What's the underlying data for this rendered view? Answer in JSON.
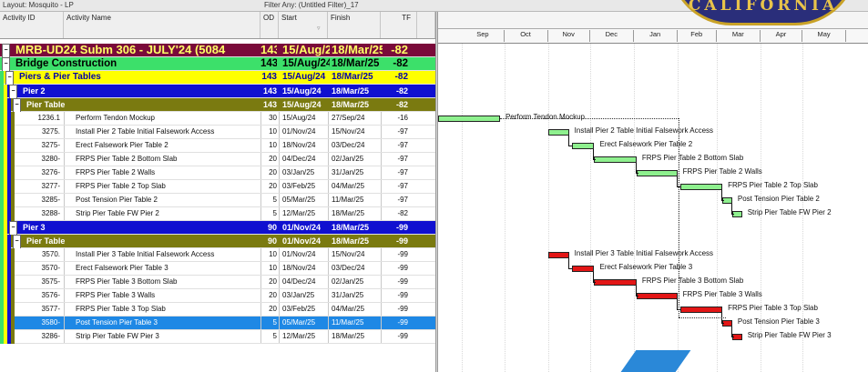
{
  "toolbar": {
    "layout_label": "Layout: Mosquito - LP",
    "filter_label": "Filter Any: (Untitled Filter)_17"
  },
  "columns": {
    "activity_id": "Activity ID",
    "activity_name": "Activity Name",
    "od": "OD",
    "start": "Start",
    "finish": "Finish",
    "tf": "TF"
  },
  "timeline": {
    "months": [
      "Sep",
      "Oct",
      "Nov",
      "Dec",
      "Jan",
      "Feb",
      "Mar",
      "Apr",
      "May"
    ]
  },
  "seal_text": "CALIFORNIA",
  "colors": {
    "wbs1": "#7a0a3a",
    "wbs2": "#3ce06a",
    "wbs3": "#ffff00",
    "wbs4": "#1010d0",
    "wbs5": "#7a7a10",
    "selected": "#1e88e5",
    "bar_green": "#8ef08e",
    "bar_red": "#e31616"
  },
  "rows": [
    {
      "kind": "band",
      "level": 1,
      "id": "",
      "name": "MRB-UD24 Subm 306 - JULY'24 (5084",
      "od": "143",
      "start": "15/Aug/24",
      "finish": "18/Mar/25",
      "tf": "-82"
    },
    {
      "kind": "band",
      "level": 2,
      "id": "",
      "name": "Bridge Construction",
      "od": "143",
      "start": "15/Aug/24",
      "finish": "18/Mar/25",
      "tf": "-82"
    },
    {
      "kind": "band",
      "level": 3,
      "id": "",
      "name": "Piers & Pier Tables",
      "od": "143",
      "start": "15/Aug/24",
      "finish": "18/Mar/25",
      "tf": "-82"
    },
    {
      "kind": "band",
      "level": 4,
      "id": "",
      "name": "Pier 2",
      "od": "143",
      "start": "15/Aug/24",
      "finish": "18/Mar/25",
      "tf": "-82"
    },
    {
      "kind": "band",
      "level": 5,
      "id": "",
      "name": "Pier Table",
      "od": "143",
      "start": "15/Aug/24",
      "finish": "18/Mar/25",
      "tf": "-82"
    },
    {
      "kind": "act",
      "id": "1236.1",
      "name": "Perform Tendon Mockup",
      "od": "30",
      "start": "15/Aug/24",
      "finish": "27/Sep/24",
      "tf": "-16"
    },
    {
      "kind": "act",
      "id": "3275.",
      "name": "Install Pier 2 Table Initial Falsework Access",
      "od": "10",
      "start": "01/Nov/24",
      "finish": "15/Nov/24",
      "tf": "-97"
    },
    {
      "kind": "act",
      "id": "3275-",
      "name": "Erect Falsework Pier Table 2",
      "od": "10",
      "start": "18/Nov/24",
      "finish": "03/Dec/24",
      "tf": "-97"
    },
    {
      "kind": "act",
      "id": "3280-",
      "name": "FRPS Pier Table 2 Bottom Slab",
      "od": "20",
      "start": "04/Dec/24",
      "finish": "02/Jan/25",
      "tf": "-97"
    },
    {
      "kind": "act",
      "id": "3276-",
      "name": "FRPS Pier Table 2 Walls",
      "od": "20",
      "start": "03/Jan/25",
      "finish": "31/Jan/25",
      "tf": "-97"
    },
    {
      "kind": "act",
      "id": "3277-",
      "name": "FRPS Pier Table 2 Top Slab",
      "od": "20",
      "start": "03/Feb/25",
      "finish": "04/Mar/25",
      "tf": "-97"
    },
    {
      "kind": "act",
      "id": "3285-",
      "name": "Post Tension Pier Table 2",
      "od": "5",
      "start": "05/Mar/25",
      "finish": "11/Mar/25",
      "tf": "-97"
    },
    {
      "kind": "act",
      "id": "3288-",
      "name": "Strip Pier Table FW Pier 2",
      "od": "5",
      "start": "12/Mar/25",
      "finish": "18/Mar/25",
      "tf": "-82"
    },
    {
      "kind": "band",
      "level": 4,
      "id": "",
      "name": "Pier 3",
      "od": "90",
      "start": "01/Nov/24",
      "finish": "18/Mar/25",
      "tf": "-99"
    },
    {
      "kind": "band",
      "level": 5,
      "id": "",
      "name": "Pier Table",
      "od": "90",
      "start": "01/Nov/24",
      "finish": "18/Mar/25",
      "tf": "-99"
    },
    {
      "kind": "act",
      "id": "3570.",
      "name": "Install Pier 3 Table Initial Falsework Access",
      "od": "10",
      "start": "01/Nov/24",
      "finish": "15/Nov/24",
      "tf": "-99"
    },
    {
      "kind": "act",
      "id": "3570-",
      "name": "Erect Falsework Pier Table 3",
      "od": "10",
      "start": "18/Nov/24",
      "finish": "03/Dec/24",
      "tf": "-99"
    },
    {
      "kind": "act",
      "id": "3575-",
      "name": "FRPS Pier Table 3 Bottom Slab",
      "od": "20",
      "start": "04/Dec/24",
      "finish": "02/Jan/25",
      "tf": "-99"
    },
    {
      "kind": "act",
      "id": "3576-",
      "name": "FRPS Pier Table 3 Walls",
      "od": "20",
      "start": "03/Jan/25",
      "finish": "31/Jan/25",
      "tf": "-99"
    },
    {
      "kind": "act",
      "id": "3577-",
      "name": "FRPS Pier Table 3 Top Slab",
      "od": "20",
      "start": "03/Feb/25",
      "finish": "04/Mar/25",
      "tf": "-99"
    },
    {
      "kind": "act",
      "selected": true,
      "id": "3580-",
      "name": "Post Tension Pier Table 3",
      "od": "5",
      "start": "05/Mar/25",
      "finish": "11/Mar/25",
      "tf": "-99"
    },
    {
      "kind": "act",
      "id": "3286-",
      "name": "Strip Pier Table FW Pier 3",
      "od": "5",
      "start": "12/Mar/25",
      "finish": "18/Mar/25",
      "tf": "-99"
    }
  ],
  "bars": [
    {
      "row": 5,
      "color": "green",
      "label": "Perform Tendon Mockup",
      "start": "2024-08-15",
      "end": "2024-09-27"
    },
    {
      "row": 6,
      "color": "green",
      "label": "Install Pier 2 Table Initial Falsework Access",
      "start": "2024-11-01",
      "end": "2024-11-15"
    },
    {
      "row": 7,
      "color": "green",
      "label": "Erect Falsework Pier Table 2",
      "start": "2024-11-18",
      "end": "2024-12-03"
    },
    {
      "row": 8,
      "color": "green",
      "label": "FRPS Pier Table 2 Bottom Slab",
      "start": "2024-12-04",
      "end": "2025-01-02"
    },
    {
      "row": 9,
      "color": "green",
      "label": "FRPS Pier Table 2 Walls",
      "start": "2025-01-03",
      "end": "2025-01-31"
    },
    {
      "row": 10,
      "color": "green",
      "label": "FRPS Pier Table 2 Top Slab",
      "start": "2025-02-03",
      "end": "2025-03-04"
    },
    {
      "row": 11,
      "color": "green",
      "label": "Post Tension Pier Table 2",
      "start": "2025-03-05",
      "end": "2025-03-11"
    },
    {
      "row": 12,
      "color": "green",
      "label": "Strip Pier Table FW Pier 2",
      "start": "2025-03-12",
      "end": "2025-03-18"
    },
    {
      "row": 15,
      "color": "red",
      "label": "Install Pier 3 Table Initial Falsework Access",
      "start": "2024-11-01",
      "end": "2024-11-15"
    },
    {
      "row": 16,
      "color": "red",
      "label": "Erect Falsework Pier Table 3",
      "start": "2024-11-18",
      "end": "2024-12-03"
    },
    {
      "row": 17,
      "color": "red",
      "label": "FRPS Pier Table 3 Bottom Slab",
      "start": "2024-12-04",
      "end": "2025-01-02"
    },
    {
      "row": 18,
      "color": "red",
      "label": "FRPS Pier Table 3 Walls",
      "start": "2025-01-03",
      "end": "2025-01-31"
    },
    {
      "row": 19,
      "color": "red",
      "label": "FRPS Pier Table 3 Top Slab",
      "start": "2025-02-03",
      "end": "2025-03-04"
    },
    {
      "row": 20,
      "color": "red",
      "label": "Post Tension Pier Table 3",
      "start": "2025-03-05",
      "end": "2025-03-11"
    },
    {
      "row": 21,
      "color": "red",
      "label": "Strip Pier Table FW Pier 3",
      "start": "2025-03-12",
      "end": "2025-03-18"
    }
  ]
}
